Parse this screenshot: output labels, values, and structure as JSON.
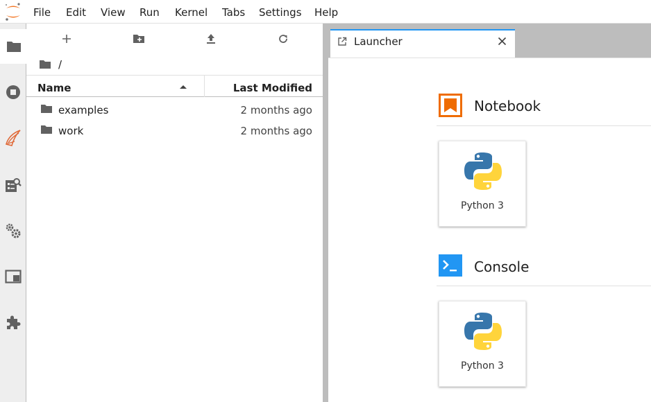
{
  "menubar": {
    "items": [
      "File",
      "Edit",
      "View",
      "Run",
      "Kernel",
      "Tabs",
      "Settings",
      "Help"
    ]
  },
  "sidebar": {
    "tabs": [
      "folder-icon",
      "running-icon",
      "git-icon",
      "property-inspector-icon",
      "settings-icon",
      "tabs-icon",
      "extension-icon"
    ]
  },
  "filebrowser": {
    "toolbar": [
      "new-launcher-icon",
      "new-folder-icon",
      "upload-icon",
      "refresh-icon"
    ],
    "breadcrumb": "/",
    "columns": {
      "name": "Name",
      "modified": "Last Modified"
    },
    "rows": [
      {
        "name": "examples",
        "modified": "2 months ago"
      },
      {
        "name": "work",
        "modified": "2 months ago"
      }
    ]
  },
  "tabs": {
    "launcher": {
      "label": "Launcher"
    }
  },
  "launcher": {
    "notebook": {
      "title": "Notebook",
      "card_label": "Python 3"
    },
    "console": {
      "title": "Console",
      "card_label": "Python 3"
    }
  },
  "colors": {
    "accent": "#2196f3",
    "notebook_orange": "#ef6c00",
    "console_blue": "#2196f3",
    "python_blue": "#3776ab",
    "python_yellow": "#ffd43b"
  }
}
